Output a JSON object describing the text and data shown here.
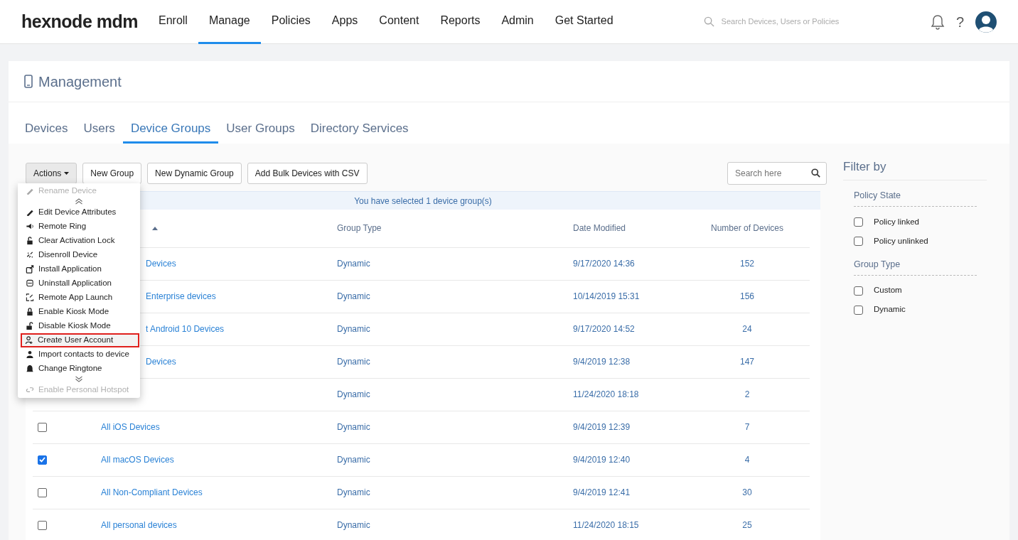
{
  "brand": "hexnode mdm",
  "nav": [
    {
      "label": "Enroll",
      "selected": false
    },
    {
      "label": "Manage",
      "selected": true
    },
    {
      "label": "Policies",
      "selected": false
    },
    {
      "label": "Apps",
      "selected": false
    },
    {
      "label": "Content",
      "selected": false
    },
    {
      "label": "Reports",
      "selected": false
    },
    {
      "label": "Admin",
      "selected": false
    },
    {
      "label": "Get Started",
      "selected": false
    }
  ],
  "global_search": {
    "placeholder": "Search Devices, Users or Policies"
  },
  "help": "?",
  "page_title": "Management",
  "tabs": [
    {
      "label": "Devices",
      "selected": false
    },
    {
      "label": "Users",
      "selected": false
    },
    {
      "label": "Device Groups",
      "selected": true
    },
    {
      "label": "User Groups",
      "selected": false
    },
    {
      "label": "Directory Services",
      "selected": false
    }
  ],
  "toolbar": {
    "actions_button": "Actions",
    "buttons": [
      "New Group",
      "New Dynamic Group",
      "Add Bulk Devices with CSV"
    ],
    "search": {
      "placeholder": "Search here"
    }
  },
  "actions_menu": [
    {
      "label": "Rename Device",
      "faded": true,
      "highlighted": false
    },
    {
      "label": "Edit Device Attributes",
      "faded": false,
      "highlighted": false
    },
    {
      "label": "Remote Ring",
      "faded": false,
      "highlighted": false
    },
    {
      "label": "Clear Activation Lock",
      "faded": false,
      "highlighted": false
    },
    {
      "label": "Disenroll Device",
      "faded": false,
      "highlighted": false
    },
    {
      "label": "Install Application",
      "faded": false,
      "highlighted": false
    },
    {
      "label": "Uninstall Application",
      "faded": false,
      "highlighted": false
    },
    {
      "label": "Remote App Launch",
      "faded": false,
      "highlighted": false
    },
    {
      "label": "Enable Kiosk Mode",
      "faded": false,
      "highlighted": false
    },
    {
      "label": "Disable Kiosk Mode",
      "faded": false,
      "highlighted": false
    },
    {
      "label": "Create User Account",
      "faded": false,
      "highlighted": true
    },
    {
      "label": "Import contacts to device",
      "faded": false,
      "highlighted": false
    },
    {
      "label": "Change Ringtone",
      "faded": false,
      "highlighted": false
    },
    {
      "label": "Enable Personal Hotspot",
      "faded": true,
      "highlighted": false
    }
  ],
  "table": {
    "banner": "You have selected 1 device group(s)",
    "columns": [
      "Group Type",
      "Date Modified",
      "Number of Devices"
    ],
    "rows": [
      {
        "name": "Devices",
        "group_type": "Dynamic",
        "date_modified": "9/17/2020 14:36",
        "number_of_devices": "152"
      },
      {
        "name": "Enterprise devices",
        "group_type": "Dynamic",
        "date_modified": "10/14/2019 15:31",
        "number_of_devices": "156"
      },
      {
        "name": "t Android 10 Devices",
        "group_type": "Dynamic",
        "date_modified": "9/17/2020 14:52",
        "number_of_devices": "24"
      },
      {
        "name": "Devices",
        "group_type": "Dynamic",
        "date_modified": "9/4/2019 12:38",
        "number_of_devices": "147"
      },
      {
        "group_type": "Dynamic",
        "date_modified": "11/24/2020 18:18",
        "number_of_devices": "2"
      },
      {
        "name": "All iOS Devices",
        "checked": false,
        "group_type": "Dynamic",
        "date_modified": "9/4/2019 12:39",
        "number_of_devices": "7"
      },
      {
        "name": "All macOS Devices",
        "checked": true,
        "group_type": "Dynamic",
        "date_modified": "9/4/2019 12:40",
        "number_of_devices": "4"
      },
      {
        "name": "All Non-Compliant Devices",
        "checked": false,
        "group_type": "Dynamic",
        "date_modified": "9/4/2019 12:41",
        "number_of_devices": "30"
      },
      {
        "name": "All personal devices",
        "checked": false,
        "group_type": "Dynamic",
        "date_modified": "11/24/2020 18:15",
        "number_of_devices": "25"
      }
    ]
  },
  "filter": {
    "title": "Filter by",
    "sections": [
      {
        "heading": "Policy State",
        "options": [
          {
            "label": "Policy linked",
            "checked": false
          },
          {
            "label": "Policy unlinked",
            "checked": false
          }
        ]
      },
      {
        "heading": "Group Type",
        "options": [
          {
            "label": "Custom",
            "checked": false
          },
          {
            "label": "Dynamic",
            "checked": false
          }
        ]
      }
    ]
  }
}
